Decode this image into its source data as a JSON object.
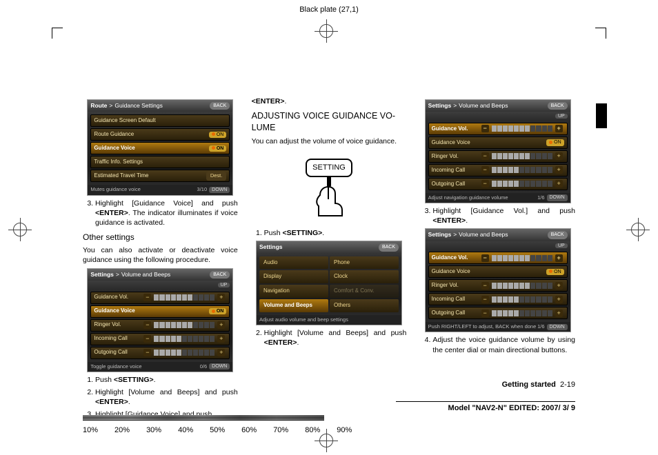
{
  "page": {
    "black_plate": "Black plate (27,1)",
    "section_footer": "Getting started",
    "page_number": "2-19",
    "model_line": "Model \"NAV2-N\" EDITED: 2007/ 3/ 9",
    "percents": [
      "10%",
      "20%",
      "30%",
      "40%",
      "50%",
      "60%",
      "70%",
      "80%",
      "90%"
    ]
  },
  "col1": {
    "screen1": {
      "crumb1": "Route",
      "sep": ">",
      "crumb2": "Guidance Settings",
      "back": "BACK",
      "rows": [
        "Guidance Screen Default",
        "Route Guidance",
        "Guidance Voice",
        "Traffic Info. Settings",
        "Estimated Travel Time"
      ],
      "on": "ON",
      "dest": "Dest.",
      "page": "3/10",
      "down": "DOWN",
      "hint": "Mutes guidance voice"
    },
    "step3_a": "Highlight [Guidance Voice] and push ",
    "step3_b": "<ENTER>",
    "step3_c": ". The indicator illuminates if voice guidance is activated.",
    "other_heading": "Other settings",
    "other_p": "You can also activate or deactivate voice guidance using the following procedure.",
    "screen2": {
      "crumb1": "Settings",
      "sep": ">",
      "crumb2": "Volume and Beeps",
      "back": "BACK",
      "up": "UP",
      "rows": [
        "Guidance Vol.",
        "Guidance Voice",
        "Ringer Vol.",
        "Incoming Call",
        "Outgoing Call"
      ],
      "on": "ON",
      "page": "0/6",
      "down": "DOWN",
      "hint": "Toggle guidance voice"
    },
    "li1_a": "Push ",
    "li1_b": "<SETTING>",
    "li1_c": ".",
    "li2_a": "Highlight [Volume and Beeps] and push ",
    "li2_b": "<ENTER>",
    "li2_c": ".",
    "li3_a": "Highlight [Guidance Voice] and push"
  },
  "col2": {
    "enter": "<ENTER>",
    "dot": ".",
    "heading": "ADJUSTING VOICE GUIDANCE VO-\nLUME",
    "p1": "You can adjust the volume of voice guidance.",
    "button_label": "SETTING",
    "li1_a": "Push ",
    "li1_b": "<SETTING>",
    "li1_c": ".",
    "screen3": {
      "title": "Settings",
      "back": "BACK",
      "cells": [
        "Audio",
        "Phone",
        "Display",
        "Clock",
        "Navigation",
        "Comfort & Conv.",
        "Volume and Beeps",
        "Others"
      ],
      "hint": "Adjust audio volume and beep settings"
    },
    "li2_a": "Highlight [Volume and Beeps] and push ",
    "li2_b": "<ENTER>",
    "li2_c": "."
  },
  "col3": {
    "screen4": {
      "crumb1": "Settings",
      "sep": ">",
      "crumb2": "Volume and Beeps",
      "back": "BACK",
      "up": "UP",
      "rows": [
        "Guidance Vol.",
        "Guidance Voice",
        "Ringer Vol.",
        "Incoming Call",
        "Outgoing Call"
      ],
      "on": "ON",
      "page": "1/6",
      "down": "DOWN",
      "hint": "Adjust navigation guidance volume"
    },
    "step3_a": "Highlight [Guidance Vol.] and push ",
    "step3_b": "<ENTER>",
    "step3_c": ".",
    "screen5": {
      "crumb1": "Settings",
      "sep": ">",
      "crumb2": "Volume and Beeps",
      "back": "BACK",
      "up": "UP",
      "rows": [
        "Guidance Vol.",
        "Guidance Voice",
        "Ringer Vol.",
        "Incoming Call",
        "Outgoing Call"
      ],
      "on": "ON",
      "page": "1/6",
      "down": "DOWN",
      "hint": "Push RIGHT/LEFT to adjust, BACK when done"
    },
    "step4": "Adjust the voice guidance volume by using the center dial or main directional buttons."
  }
}
